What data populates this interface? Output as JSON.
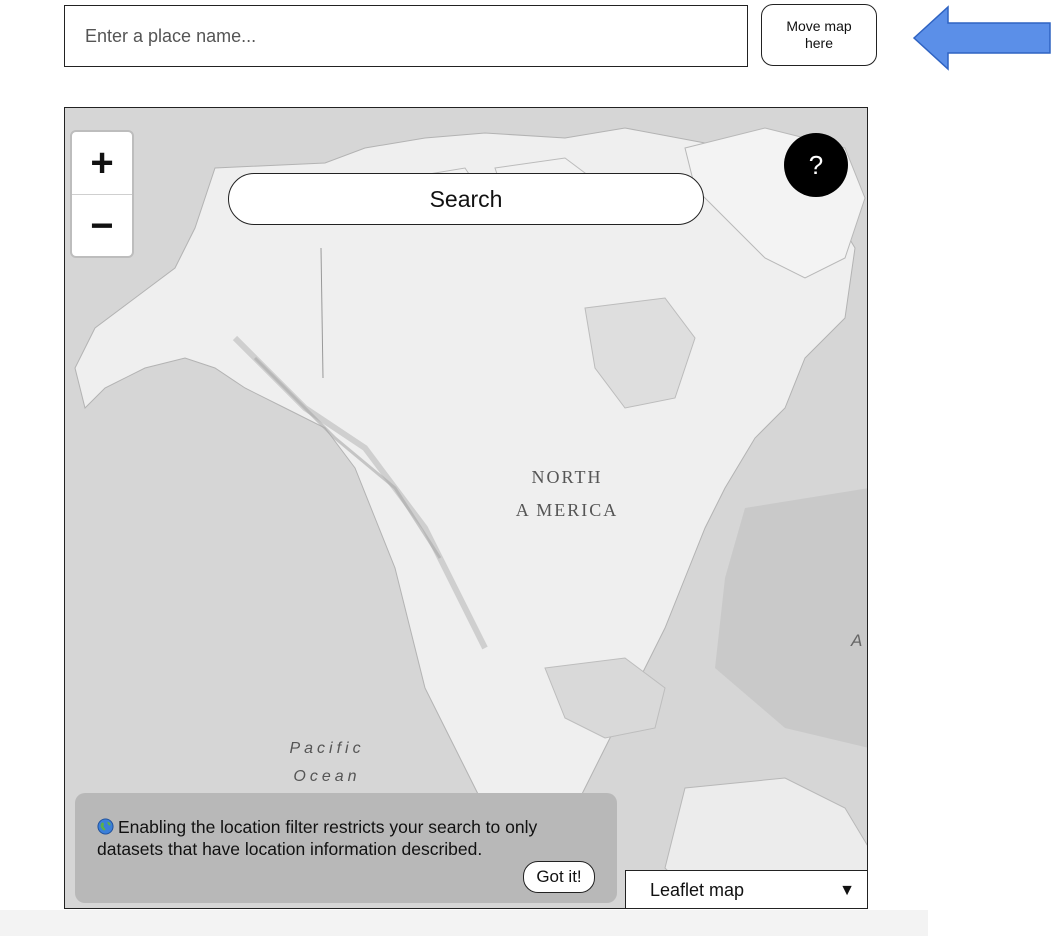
{
  "place_search": {
    "placeholder": "Enter a place name...",
    "move_button_label": "Move map here"
  },
  "map": {
    "zoom_in_label": "+",
    "zoom_out_label": "−",
    "search_button_label": "Search",
    "help_button_label": "?",
    "labels": {
      "north": "NORTH",
      "america": "A MERICA",
      "pacific": "Pacific",
      "ocean": "Ocean",
      "partial_atlantic": "A"
    },
    "info_toast": {
      "icon": "globe-icon",
      "text": "Enabling the location filter restricts your search to only datasets that have location information described.",
      "dismiss_label": "Got it!"
    },
    "basemap_select": {
      "selected": "Leaflet map",
      "caret": "▼"
    }
  },
  "colors": {
    "arrow": "#5b8fe8",
    "arrow_stroke": "#2f63c2",
    "toast_bg": "#b8b8b8",
    "help_bg": "#000000"
  }
}
